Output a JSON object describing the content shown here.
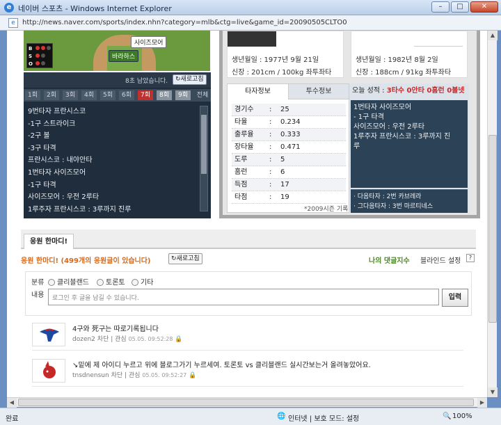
{
  "window": {
    "title": "네이버 스포츠 - Windows Internet Explorer",
    "url": "http://news.naver.com/sports/index.nhn?category=mlb&ctg=live&game_id=20090505CLTO0"
  },
  "field": {
    "batter_tag": "바라하스",
    "runner_tag": "사이즈모어",
    "bso": [
      "B",
      "S",
      "O"
    ]
  },
  "live": {
    "timer_text": "8초 남았습니다.",
    "refresh_label": "새로고침",
    "innings": [
      "1회",
      "2회",
      "3회",
      "4회",
      "5회",
      "6회",
      "7회",
      "8회",
      "9회",
      "전체"
    ],
    "active_inning": "7회",
    "pbp": [
      "9번타자 프란시스코",
      "-1구 스트라이크",
      "-2구 볼",
      "-3구 타격",
      "프란시스코 : 내야안타",
      "1번타자 사이즈모어",
      "-1구 타격",
      "사이즈모어 : 우전 2루타",
      "1루주자 프란시스코 : 3루까지 진루"
    ]
  },
  "bio_left": {
    "birth": "생년월일 : 1977년 9월 21일",
    "body": "신장 : 201cm / 100kg 좌투좌타"
  },
  "bio_right": {
    "birth": "생년월일 : 1982년 8월 2일",
    "body": "신장 : 188cm / 91kg 좌투좌타"
  },
  "stats": {
    "tab_batting": "타자정보",
    "tab_pitching": "투수정보",
    "rows": [
      {
        "key": "경기수",
        "value": "25"
      },
      {
        "key": "타율",
        "value": "0.234"
      },
      {
        "key": "출루율",
        "value": "0.333"
      },
      {
        "key": "장타율",
        "value": "0.471"
      },
      {
        "key": "도루",
        "value": "5"
      },
      {
        "key": "홈런",
        "value": "6"
      },
      {
        "key": "득점",
        "value": "17"
      },
      {
        "key": "타점",
        "value": "19"
      }
    ],
    "note": "*2009시즌 기록"
  },
  "today": {
    "label": "오늘 성적 : ",
    "value": "3타수 0안타 0홈런 0볼넷",
    "lines": [
      "1번타자 사이즈모어",
      "- 1구 타격",
      "사이즈모어 : 우전 2루타",
      "1루주자 프란시스코 : 3루까지 진",
      "루"
    ],
    "next1": "· 다음타자 : 2번 카브레라",
    "next2": "· 그다음타자 : 3번 마르티네스"
  },
  "cheer": {
    "tab": "응원 한마디!",
    "title": "응원 한마디! (499개의 응원글이 있습니다)",
    "refresh": "새로고침",
    "my_comments": "나의 댓글지수",
    "blind": "블라인드 설정",
    "help": "?",
    "category_label": "분류",
    "options": [
      "클리블랜드",
      "토론토",
      "기타"
    ],
    "content_label": "내용",
    "placeholder": "로그인 후 글을 남길 수 있습니다.",
    "submit": "입력",
    "comments": [
      {
        "text": "4구와 死구는 따로기록됩니다",
        "user": "dozen2",
        "block": "차단",
        "like": "관심",
        "time": "05.05. 09:52:28"
      },
      {
        "text": "↘밑에 제 아이디 누르고 위에 블로그가기 누르세여. 토론토 vs 클리블랜드 실시간보는거 올려놓았어요.",
        "user": "tnsdnensun",
        "block": "차단",
        "like": "관심",
        "time": "05.05. 09:52:27"
      }
    ]
  },
  "statusbar": {
    "left": "완료",
    "zone": "인터넷 | 보호 모드: 설정",
    "zoom": "100%"
  },
  "colors": {
    "active_inning": "#c0302e",
    "dark_panel": "#1f2d3c",
    "cheer_title": "#d2691e",
    "my_comments": "#4a8a23"
  }
}
